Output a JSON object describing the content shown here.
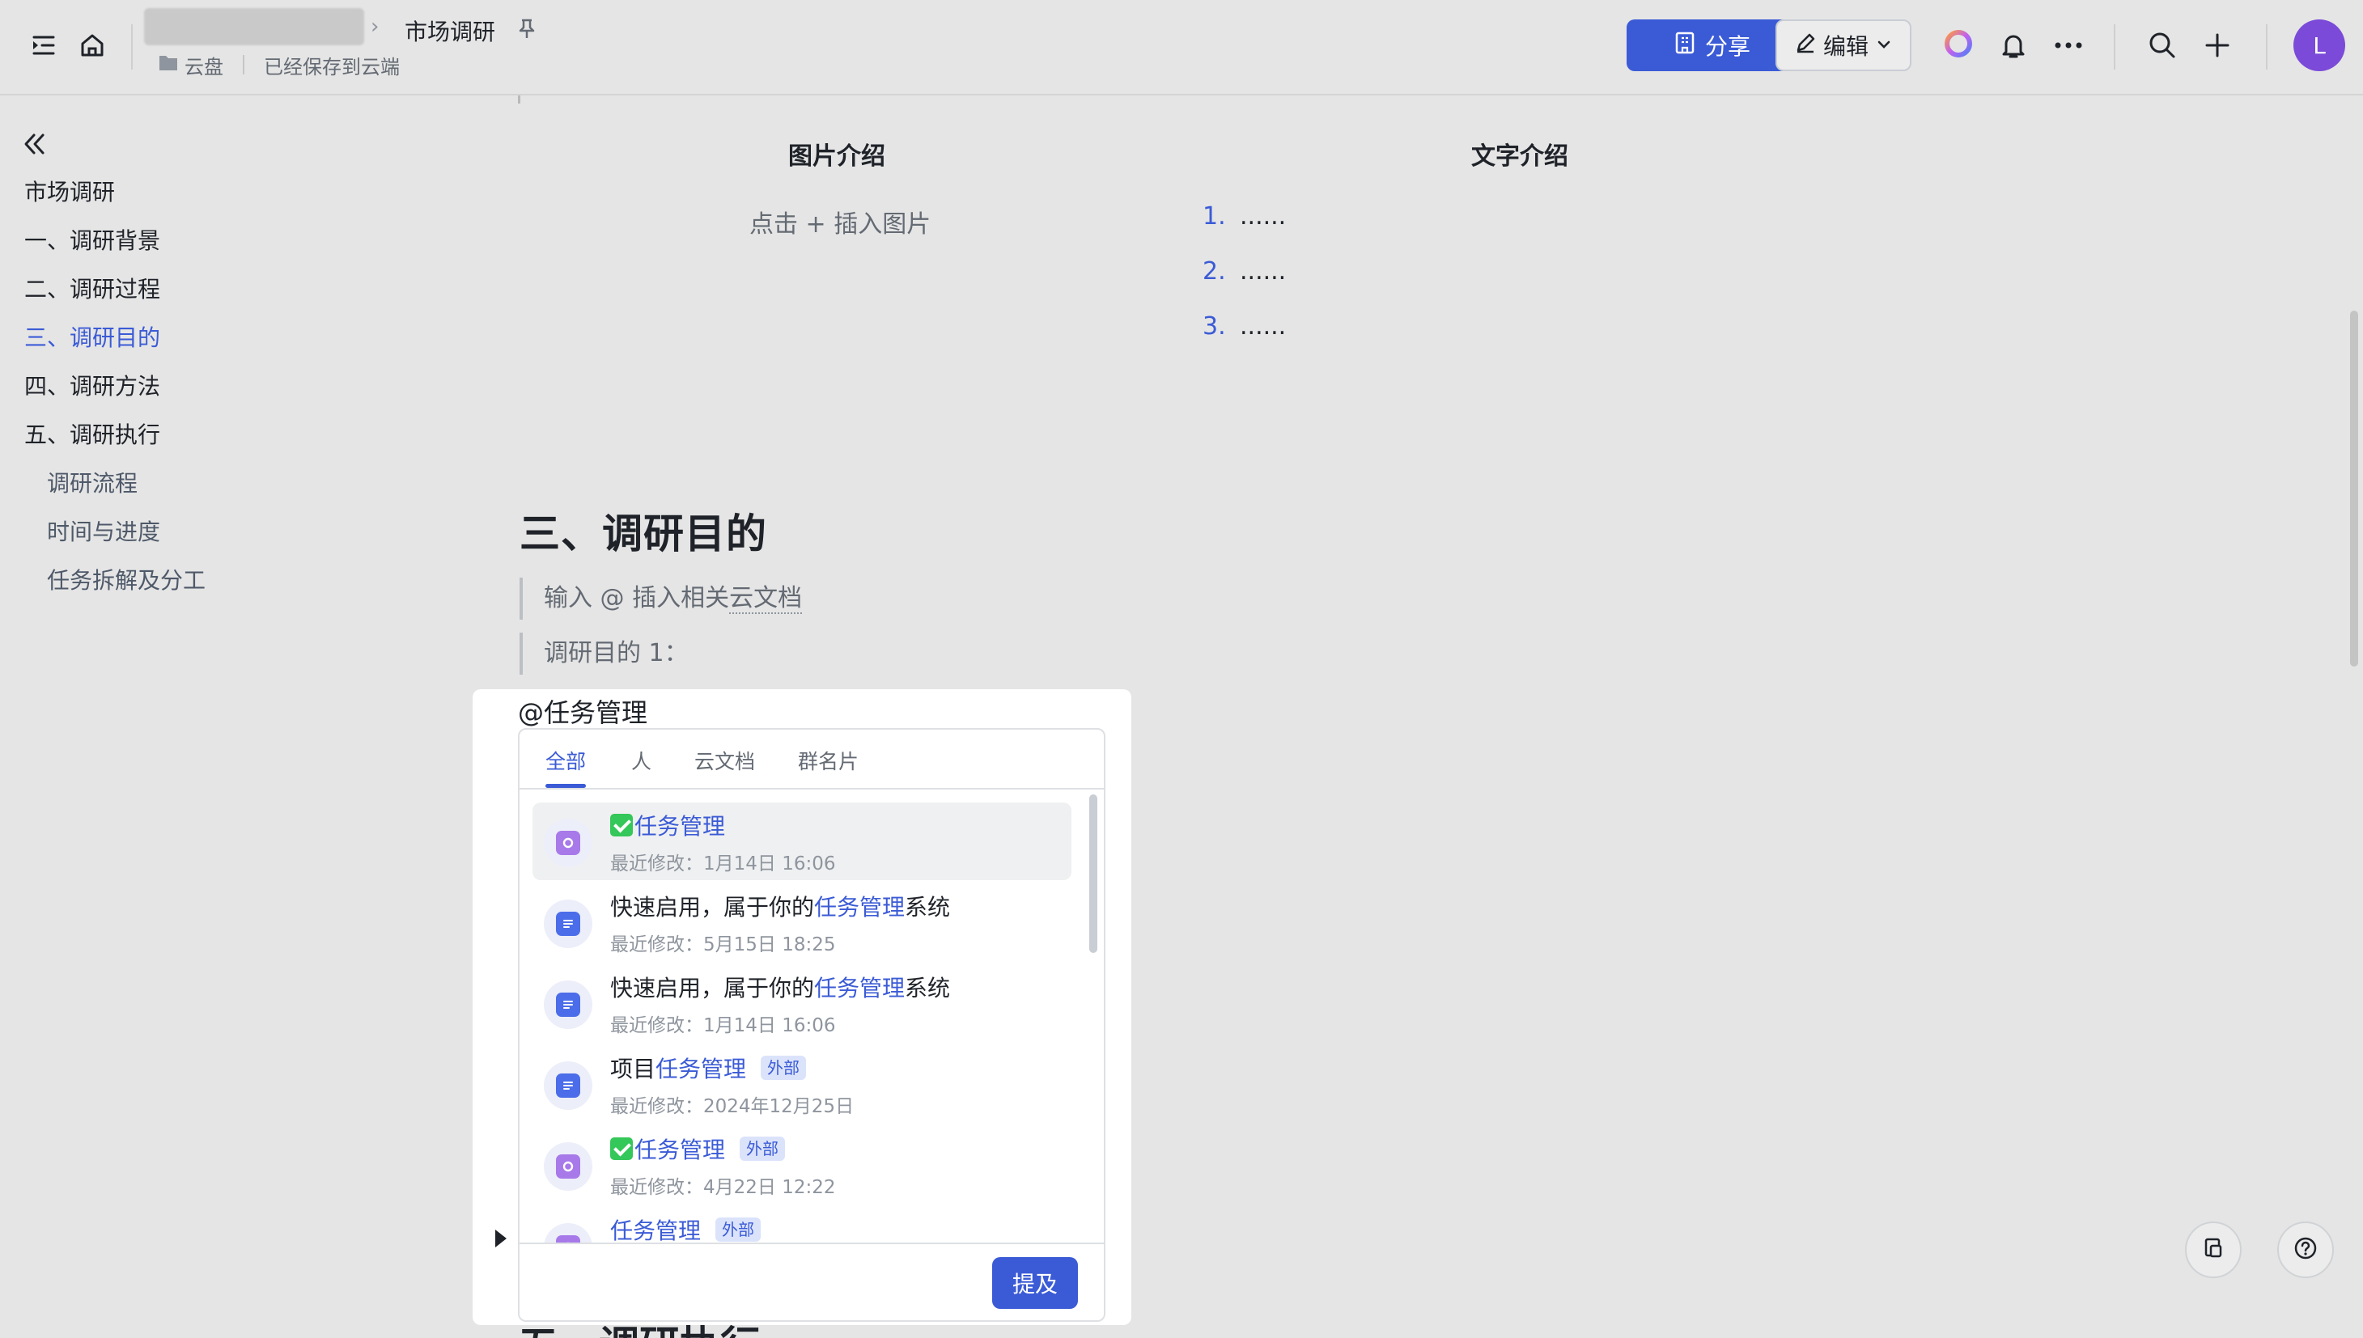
{
  "header": {
    "doc_title": "市场调研",
    "location": "云盘",
    "save_status": "已经保存到云端",
    "share_label": "分享",
    "edit_label": "编辑",
    "avatar_initial": "L"
  },
  "sidebar": {
    "items": [
      {
        "label": "市场调研"
      },
      {
        "label": "一、调研背景"
      },
      {
        "label": "二、调研过程"
      },
      {
        "label": "三、调研目的"
      },
      {
        "label": "四、调研方法"
      },
      {
        "label": "五、调研执行"
      },
      {
        "label": "调研流程"
      },
      {
        "label": "时间与进度"
      },
      {
        "label": "任务拆解及分工"
      }
    ]
  },
  "doc": {
    "col1_title": "图片介绍",
    "col2_title": "文字介绍",
    "image_hint": "点击 + 插入图片",
    "list": [
      {
        "num": "1.",
        "text": "......"
      },
      {
        "num": "2.",
        "text": "......"
      },
      {
        "num": "3.",
        "text": "......"
      }
    ],
    "heading": "三、调研目的",
    "quote1_pre": "输入 @ 插入相关",
    "quote1_link": "云文档",
    "quote2": "调研目的 1：",
    "next_heading": "五、调研执行"
  },
  "mention": {
    "query": "@任务管理",
    "tabs": [
      "全部",
      "人",
      "云文档",
      "群名片"
    ],
    "results": [
      {
        "pre": "",
        "hl": "任务管理",
        "post": "",
        "meta": "最近修改：1月14日 16:06",
        "badge": ""
      },
      {
        "pre": "快速启用，属于你的",
        "hl": "任务管理",
        "post": "系统",
        "meta": "最近修改：5月15日 18:25",
        "badge": ""
      },
      {
        "pre": "快速启用，属于你的",
        "hl": "任务管理",
        "post": "系统",
        "meta": "最近修改：1月14日 16:06",
        "badge": ""
      },
      {
        "pre": "项目",
        "hl": "任务管理",
        "post": "",
        "meta": "最近修改：2024年12月25日",
        "badge": "外部"
      },
      {
        "pre": "",
        "hl": "任务管理",
        "post": "",
        "meta": "最近修改：4月22日 12:22",
        "badge": "外部"
      },
      {
        "pre": "",
        "hl": "任务管理",
        "post": "",
        "meta": "",
        "badge": "外部"
      }
    ],
    "submit_label": "提及"
  },
  "colors": {
    "accent": "#3b5bd6",
    "app_icon": "#a779e9",
    "doc_icon": "#4b6de9"
  },
  "icons": {
    "sidebar_toggle": "sidebar-toggle-icon",
    "home": "home-icon",
    "pin": "pin-icon",
    "folder": "folder-icon",
    "share": "building-icon",
    "edit": "pencil-icon",
    "ai": "ai-ring-icon",
    "notify": "bell-icon",
    "more": "more-icon",
    "search": "search-icon",
    "add": "plus-icon",
    "collapse": "double-chevron-left-icon",
    "app": "app-icon",
    "doc": "doc-icon",
    "help": "help-icon",
    "feedback": "feedback-icon"
  }
}
